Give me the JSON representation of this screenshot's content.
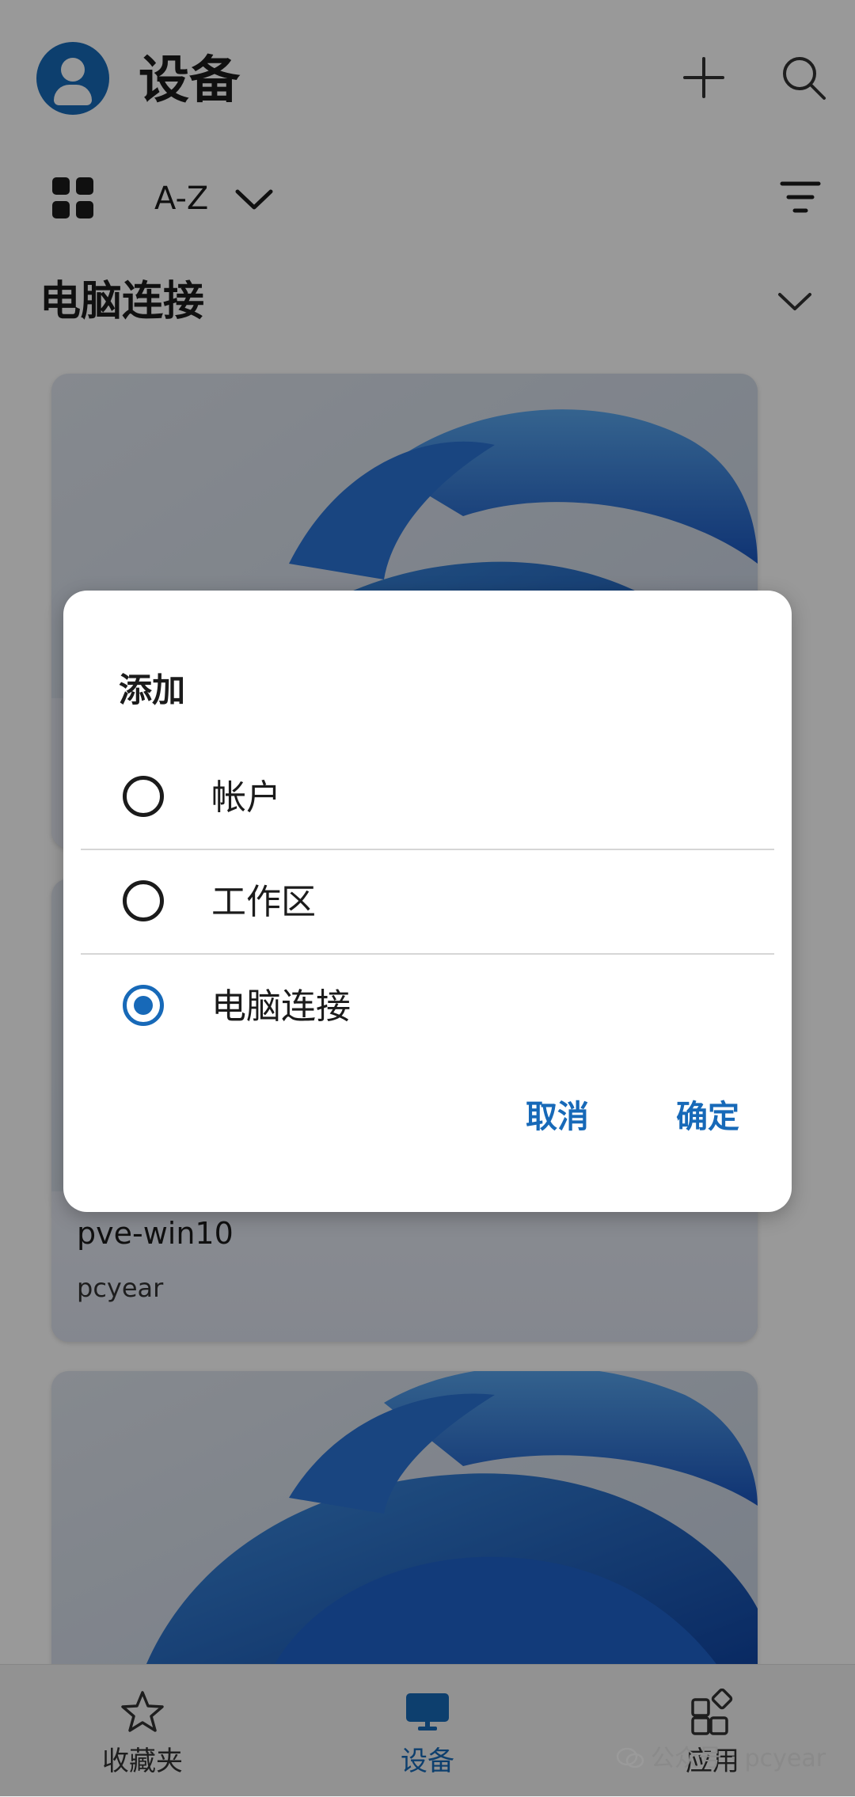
{
  "header": {
    "title": "设备",
    "avatar_icon": "person-icon",
    "add_icon": "plus-icon",
    "search_icon": "search-icon"
  },
  "toolbar": {
    "view_icon": "grid-view-icon",
    "sort_label": "A-Z",
    "filter_icon": "filter-icon"
  },
  "section": {
    "title": "电脑连接"
  },
  "cards": [
    {
      "name": "",
      "sub": ""
    },
    {
      "name": "pve-win10",
      "sub": "pcyear"
    },
    {
      "name": "",
      "sub": ""
    }
  ],
  "dialog": {
    "title": "添加",
    "options": [
      {
        "label": "帐户",
        "selected": false
      },
      {
        "label": "工作区",
        "selected": false
      },
      {
        "label": "电脑连接",
        "selected": true
      }
    ],
    "cancel_label": "取消",
    "ok_label": "确定"
  },
  "bottom_nav": {
    "items": [
      {
        "label": "收藏夹",
        "icon": "star-icon",
        "active": false
      },
      {
        "label": "设备",
        "icon": "monitor-icon",
        "active": true
      },
      {
        "label": "应用",
        "icon": "apps-icon",
        "active": false
      }
    ]
  },
  "watermark": "公众号 · pcyear",
  "colors": {
    "accent": "#1769b8",
    "scrim": "rgba(0,0,0,0.40)"
  }
}
